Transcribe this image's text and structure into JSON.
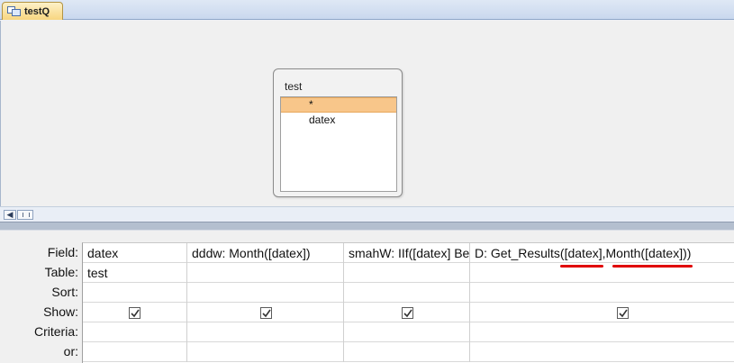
{
  "tab": {
    "label": "testQ"
  },
  "table_box": {
    "title": "test",
    "fields": [
      "*",
      "datex"
    ]
  },
  "grid": {
    "row_labels": [
      "Field:",
      "Table:",
      "Sort:",
      "Show:",
      "Criteria:",
      "or:"
    ],
    "columns": [
      {
        "field": "datex",
        "table": "test",
        "show": true
      },
      {
        "field": "dddw: Month([datex])",
        "table": "",
        "show": true
      },
      {
        "field": "smahW: IIf([datex] Between",
        "table": "",
        "show": true
      },
      {
        "field": "D: Get_Results([datex],Month([datex]))",
        "table": "",
        "show": true
      }
    ]
  },
  "colors": {
    "annotation_underline": "#e00000",
    "selected_field": "#f8c68a"
  }
}
